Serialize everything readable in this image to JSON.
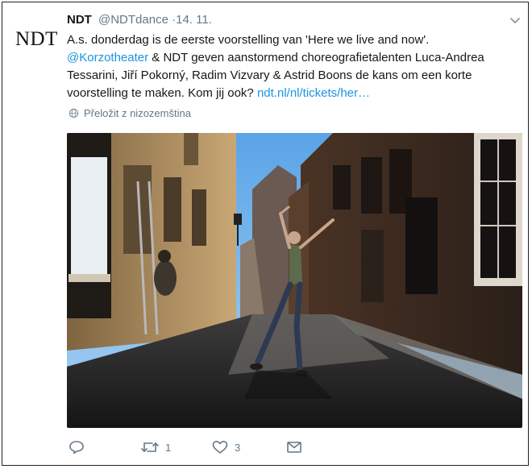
{
  "tweet": {
    "avatar_text": "NDT",
    "author_name": "NDT",
    "author_handle": "@NDTdance",
    "separator": "·",
    "timestamp": "14. 11.",
    "text": {
      "line1": "A.s. donderdag is de eerste voorstelling van 'Here we live and now'.",
      "mention": "@Korzotheater",
      "line2_rest": " & NDT geven aanstormend choreografietalenten Luca-Andrea",
      "line3": "Tessarini, Jiří Pokorný, Radim Vizvary & Astrid Boons de kans om een korte",
      "line4": "voorstelling te maken. Kom jij ook? ",
      "link": "ndt.nl/nl/tickets/her…"
    },
    "translate_label": "Přeložit z nizozemština",
    "actions": {
      "reply_count": "",
      "retweet_count": "1",
      "like_count": "3"
    }
  },
  "colors": {
    "link": "#1b95e0",
    "muted": "#657786",
    "text": "#14171a"
  },
  "icons": [
    "chevron-down-icon",
    "globe-icon",
    "reply-icon",
    "retweet-icon",
    "heart-icon",
    "mail-icon"
  ]
}
